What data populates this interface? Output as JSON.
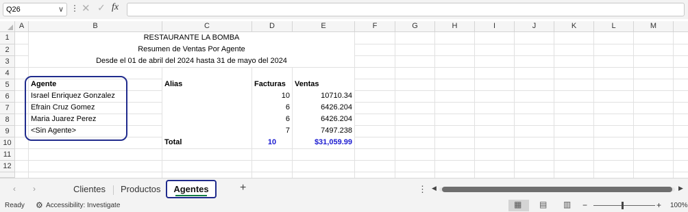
{
  "formula_bar": {
    "name_box": "Q26",
    "name_box_caret": "∨",
    "more_glyph": "⋮",
    "cancel_glyph": "✕",
    "enter_glyph": "✓",
    "fx_label": "fx",
    "formula_value": ""
  },
  "columns": [
    "A",
    "B",
    "C",
    "D",
    "E",
    "F",
    "G",
    "H",
    "I",
    "J",
    "K",
    "L",
    "M"
  ],
  "rows": [
    "1",
    "2",
    "3",
    "4",
    "5",
    "6",
    "7",
    "8",
    "9",
    "10",
    "11",
    "12"
  ],
  "report": {
    "title": "RESTAURANTE LA BOMBA",
    "subtitle": "Resumen de Ventas Por Agente",
    "period": "Desde el 01 de abril del 2024 hasta 31 de mayo del 2024"
  },
  "table": {
    "headers": {
      "agent": "Agente",
      "alias": "Alias",
      "invoices": "Facturas",
      "sales": "Ventas"
    },
    "rows": [
      {
        "agent": "Israel Enriquez Gonzalez",
        "alias": "",
        "invoices": "10",
        "sales": "10710.34"
      },
      {
        "agent": "Efrain Cruz Gomez",
        "alias": "",
        "invoices": "6",
        "sales": "6426.204"
      },
      {
        "agent": "Maria Juarez Perez",
        "alias": "",
        "invoices": "6",
        "sales": "6426.204"
      },
      {
        "agent": "<Sin Agente>",
        "alias": "",
        "invoices": "7",
        "sales": "7497.238"
      }
    ],
    "total": {
      "label": "Total",
      "invoices": "10",
      "sales": "$31,059.99"
    }
  },
  "sheet_tabs": {
    "prev_glyph": "‹",
    "next_glyph": "›",
    "tabs": [
      "Clientes",
      "Productos",
      "Agentes"
    ],
    "active": "Agentes",
    "add_glyph": "+",
    "options_glyph": "⋮"
  },
  "status_bar": {
    "ready": "Ready",
    "accessibility": "Accessibility: Investigate",
    "zoom": "100%",
    "zoom_minus": "−",
    "zoom_plus": "+"
  },
  "colors": {
    "accent_outline": "#1f2a8c",
    "total_text": "#1a1ad0",
    "active_tab_underline": "#107c41"
  }
}
